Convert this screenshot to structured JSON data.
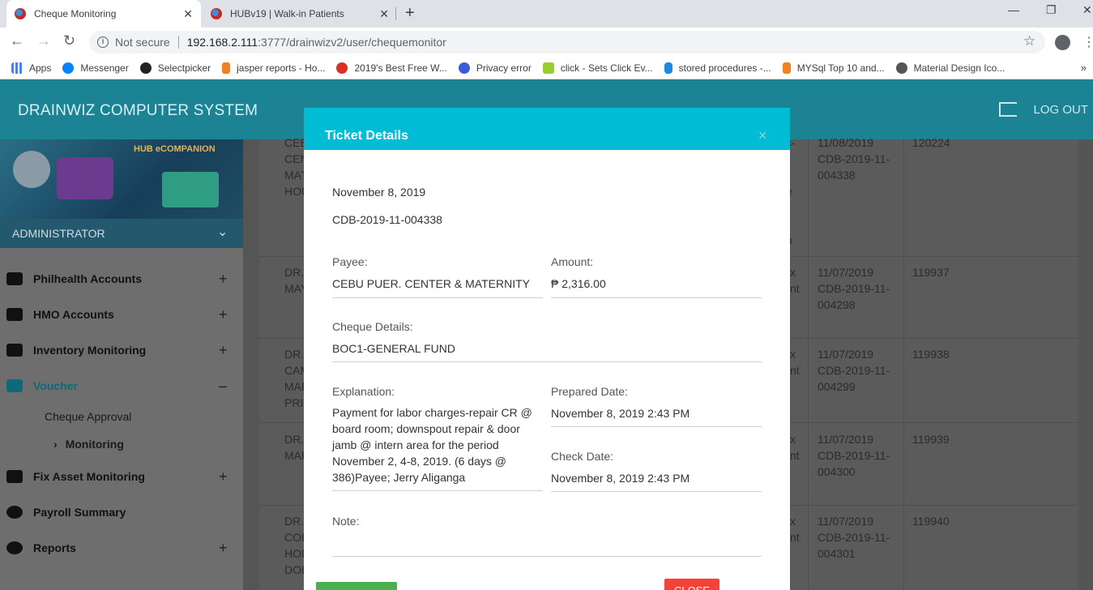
{
  "browser": {
    "tabs": [
      {
        "title": "Cheque Monitoring",
        "close": "✕"
      },
      {
        "title": "HUBv19 | Walk-in Patients",
        "close": "✕"
      }
    ],
    "new_tab": "+",
    "window_controls": {
      "minimize": "—",
      "restore": "❐",
      "close": "✕"
    },
    "nav": {
      "back": "←",
      "forward": "→",
      "reload": "↻"
    },
    "security_label": "Not secure",
    "url_host": "192.168.2.111",
    "url_path": ":3777/drainwizv2/user/chequemonitor",
    "bookmarks": [
      {
        "label": "Apps",
        "color": "#4285f4"
      },
      {
        "label": "Messenger",
        "color": "#0084ff"
      },
      {
        "label": "Selectpicker",
        "color": "#222222"
      },
      {
        "label": "jasper reports - Ho...",
        "color": "#f48024"
      },
      {
        "label": "2019's Best Free W...",
        "color": "#d93025"
      },
      {
        "label": "Privacy error",
        "color": "#3b5bdb"
      },
      {
        "label": "click - Sets Click Ev...",
        "color": "#9acd32"
      },
      {
        "label": "stored procedures -...",
        "color": "#1e88e5"
      },
      {
        "label": "MYSql Top 10 and...",
        "color": "#f48024"
      },
      {
        "label": "Material Design Ico...",
        "color": "#555555"
      }
    ],
    "bookmarks_more": "»"
  },
  "app": {
    "title": "DRAINWIZ COMPUTER SYSTEM",
    "logout": "LOG OUT",
    "banner_tag": "HUB eCOMPANION",
    "user_role": "ADMINISTRATOR",
    "menu": [
      {
        "label": "Philhealth Accounts",
        "icon": "users-icon",
        "toggle": "+"
      },
      {
        "label": "HMO Accounts",
        "icon": "monitor-icon",
        "toggle": "+"
      },
      {
        "label": "Inventory Monitoring",
        "icon": "inventory-icon",
        "toggle": "+"
      },
      {
        "label": "Voucher",
        "icon": "voucher-icon",
        "toggle": "–"
      },
      {
        "label": "Fix Asset Monitoring",
        "icon": "asset-icon",
        "toggle": "+"
      },
      {
        "label": "Payroll Summary",
        "icon": "alert-icon",
        "toggle": ""
      },
      {
        "label": "Reports",
        "icon": "reports-icon",
        "toggle": "+"
      }
    ],
    "submenu": {
      "cheque_approval": "Cheque Approval",
      "monitoring": "Monitoring",
      "caret": "›"
    }
  },
  "table": {
    "rows": [
      {
        "payee": [
          "CEB",
          "CEN",
          "MAT",
          "HOU"
        ],
        "desc": [
          "s-",
          "",
          "",
          "e",
          "",
          "",
          "a"
        ],
        "date": "11/08/2019",
        "cdb": [
          "CDB-2019-11-",
          "004338"
        ],
        "no": "120224"
      },
      {
        "payee": [
          "DR.",
          "MAY"
        ],
        "desc": [
          "x",
          "nt"
        ],
        "date": "11/07/2019",
        "cdb": [
          "CDB-2019-11-",
          "004298"
        ],
        "no": "119937"
      },
      {
        "payee": [
          "DR.",
          "CAM",
          "MAR",
          "PRI"
        ],
        "desc": [
          "x",
          "nt"
        ],
        "date": "11/07/2019",
        "cdb": [
          "CDB-2019-11-",
          "004299"
        ],
        "no": "119938"
      },
      {
        "payee": [
          "DR.",
          "MAR"
        ],
        "desc": [
          "x",
          "nt"
        ],
        "date": "11/07/2019",
        "cdb": [
          "CDB-2019-11-",
          "004300"
        ],
        "no": "119939"
      },
      {
        "payee": [
          "DR.",
          "COI",
          "HOI",
          "DOI"
        ],
        "desc": [
          "x",
          "nt"
        ],
        "date": "11/07/2019",
        "cdb": [
          "CDB-2019-11-",
          "004301"
        ],
        "no": "119940"
      }
    ]
  },
  "modal": {
    "title": "Ticket Details",
    "close_x": "×",
    "date": "November 8, 2019",
    "cdb_no": "CDB-2019-11-004338",
    "payee_label": "Payee:",
    "payee": "CEBU PUER. CENTER & MATERNITY",
    "amount_label": "Amount:",
    "amount": "₱ 2,316.00",
    "cheque_label": "Cheque Details:",
    "cheque": "BOC1-GENERAL FUND",
    "explanation_label": "Explanation:",
    "explanation": "Payment for labor charges-repair CR @ board room; downspout repair & door jamb @ intern area for the period November 2, 4-8, 2019. (6 days @ 386)Payee; Jerry Aliganga",
    "prepared_label": "Prepared Date:",
    "prepared": "November 8, 2019 2:43 PM",
    "check_date_label": "Check Date:",
    "check_date": "November 8, 2019 2:43 PM",
    "note_label": "Note:",
    "note": "",
    "close_button": "CLOSE"
  }
}
